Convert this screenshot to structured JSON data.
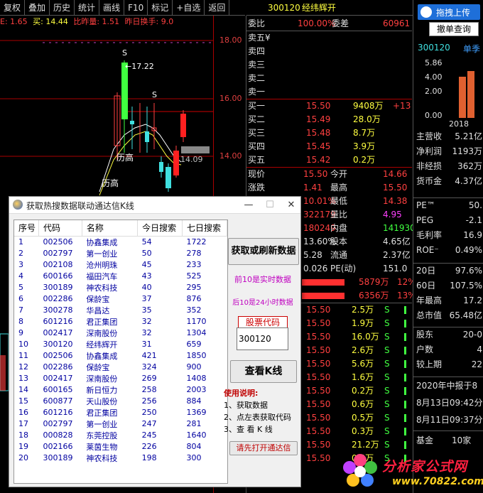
{
  "toolbar": {
    "items": [
      "复权",
      "叠加",
      "历史",
      "统计",
      "画线",
      "F10",
      "标记",
      "+自选",
      "返回"
    ]
  },
  "chart_info": {
    "prefix_label": "E: 1.65",
    "buy_label": "买: 14.44",
    "ratio_label": "比昨量: 1.51",
    "turnover_label": "昨日换手: 9.0"
  },
  "chart": {
    "price_levels": [
      "18.00",
      "16.00",
      "14.00"
    ],
    "annotations": [
      "S",
      "←17.22",
      "S",
      "历高",
      "历高",
      "14.09"
    ]
  },
  "orderbook": {
    "code": "300120",
    "name": "经纬辉开",
    "weibi_label": "委比",
    "weibi_value": "100.00%",
    "weicha_label": "委差",
    "weicha_value": "60961",
    "sell_rows": [
      {
        "label": "卖五¥",
        "price": "",
        "vol": ""
      },
      {
        "label": "卖四",
        "price": "",
        "vol": ""
      },
      {
        "label": "卖三",
        "price": "",
        "vol": ""
      },
      {
        "label": "卖二",
        "price": "",
        "vol": ""
      },
      {
        "label": "卖一",
        "price": "",
        "vol": ""
      }
    ],
    "buy_rows": [
      {
        "label": "买一",
        "price": "15.50",
        "vol": "9408万",
        "extra": "+13"
      },
      {
        "label": "买二",
        "price": "15.49",
        "vol": "28.0万",
        "extra": ""
      },
      {
        "label": "买三",
        "price": "15.48",
        "vol": "8.7万",
        "extra": ""
      },
      {
        "label": "买四",
        "price": "15.45",
        "vol": "3.9万",
        "extra": ""
      },
      {
        "label": "买五",
        "price": "15.42",
        "vol": "0.2万",
        "extra": ""
      }
    ],
    "stats": [
      {
        "l1": "现价",
        "v1": "15.50",
        "l2": "今开",
        "v2": "14.66"
      },
      {
        "l1": "涨跌",
        "v1": "1.41",
        "l2": "最高",
        "v2": "15.50"
      },
      {
        "l1": "",
        "v1": "10.01%",
        "l2": "最低",
        "v2": "14.38"
      },
      {
        "l1": "",
        "v1": "322179",
        "l2": "量比",
        "v2": "4.95"
      },
      {
        "l1": "",
        "v1": "180249",
        "l2": "内盘",
        "v2": "141930"
      },
      {
        "l1": "",
        "v1": "13.60%",
        "l2": "股本",
        "v2": "4.65亿"
      },
      {
        "l1": "",
        "v1": "5.28",
        "l2": "流通",
        "v2": "2.37亿"
      },
      {
        "l1": "",
        "v1": "0.026",
        "l2": "PE(动)",
        "v2": "151.0"
      }
    ],
    "flow_rows": [
      {
        "v": "5879万",
        "p": "12%"
      },
      {
        "v": "6356万",
        "p": "13%"
      }
    ],
    "ticks": [
      {
        "p": "15.50",
        "v": "2.5万",
        "s": "S"
      },
      {
        "p": "15.50",
        "v": "1.9万",
        "s": "S"
      },
      {
        "p": "15.50",
        "v": "16.0万",
        "s": "S"
      },
      {
        "p": "15.50",
        "v": "2.6万",
        "s": "S"
      },
      {
        "p": "15.50",
        "v": "5.6万",
        "s": "S"
      },
      {
        "p": "15.50",
        "v": "1.6万",
        "s": "S"
      },
      {
        "p": "15.50",
        "v": "0.2万",
        "s": "S"
      },
      {
        "p": "15.50",
        "v": "0.6万",
        "s": "S"
      },
      {
        "p": "15.50",
        "v": "0.5万",
        "s": "S"
      },
      {
        "p": "15.50",
        "v": "0.3万",
        "s": "S"
      },
      {
        "p": "15.50",
        "v": "21.2万",
        "s": "S"
      },
      {
        "p": "15.50",
        "v": "0.4万",
        "s": "S"
      }
    ]
  },
  "rightpanel": {
    "upload_label": "拖拽上传",
    "cancel_query_label": "撤单查询",
    "code": "300120",
    "season_label": "单季",
    "bar_axis": [
      "5.86",
      "4.00",
      "2.00",
      "0.00"
    ],
    "bar_year": "2018",
    "fin_rows": [
      {
        "l": "主营收",
        "v": "5.21亿"
      },
      {
        "l": "净利润",
        "v": "1193万"
      },
      {
        "l": "非经损",
        "v": "362万"
      },
      {
        "l": "货币金",
        "v": "4.37亿"
      }
    ],
    "ratio_rows": [
      {
        "l": "PE™",
        "v": "50."
      },
      {
        "l": "PEG",
        "v": "-2.1"
      },
      {
        "l": "毛利率",
        "v": "16.9"
      },
      {
        "l": "ROE⁻",
        "v": "0.49%"
      }
    ],
    "perf_rows": [
      {
        "l": "20日",
        "v": "97.6%"
      },
      {
        "l": "60日",
        "v": "107.5%"
      },
      {
        "l": "年最高",
        "v": "17.2"
      },
      {
        "l": "总市值",
        "v": "65.48亿"
      }
    ],
    "holder_rows": [
      {
        "l": "股东",
        "v": "20-0"
      },
      {
        "l": "户数",
        "v": "4"
      },
      {
        "l": "较上期",
        "v": "22"
      }
    ],
    "news_rows": [
      "2020年中报于8",
      "8月13日09:42分",
      "8月11日09:37分"
    ],
    "fund_label": "基金",
    "fund_value": "10家"
  },
  "dialog": {
    "title": "获取热搜数据联动通达信K线",
    "minimize": "—",
    "maximize": "☐",
    "close": "✕",
    "columns": [
      "序号",
      "代码",
      "名称",
      "今日搜索",
      "七日搜索"
    ],
    "rows": [
      [
        "1",
        "002506",
        "协鑫集成",
        "54",
        "1722"
      ],
      [
        "2",
        "002797",
        "第一创业",
        "50",
        "278"
      ],
      [
        "3",
        "002108",
        "沧州明珠",
        "45",
        "233"
      ],
      [
        "4",
        "600166",
        "福田汽车",
        "43",
        "525"
      ],
      [
        "5",
        "300189",
        "神农科技",
        "40",
        "295"
      ],
      [
        "6",
        "002286",
        "保龄宝",
        "37",
        "876"
      ],
      [
        "7",
        "300278",
        "华昌达",
        "35",
        "352"
      ],
      [
        "8",
        "601216",
        "君正集团",
        "32",
        "1170"
      ],
      [
        "9",
        "002417",
        "深南股份",
        "32",
        "1304"
      ],
      [
        "10",
        "300120",
        "经纬辉开",
        "31",
        "659"
      ],
      [
        "11",
        "002506",
        "协鑫集成",
        "421",
        "1850"
      ],
      [
        "12",
        "002286",
        "保龄宝",
        "324",
        "900"
      ],
      [
        "13",
        "002417",
        "深南股份",
        "269",
        "1408"
      ],
      [
        "14",
        "600165",
        "新日恒力",
        "258",
        "2003"
      ],
      [
        "15",
        "600877",
        "天山股份",
        "256",
        "884"
      ],
      [
        "16",
        "601216",
        "君正集团",
        "250",
        "1369"
      ],
      [
        "17",
        "002797",
        "第一创业",
        "247",
        "281"
      ],
      [
        "18",
        "000828",
        "东莞控股",
        "245",
        "1640"
      ],
      [
        "19",
        "002166",
        "莱茵生物",
        "226",
        "804"
      ],
      [
        "20",
        "300189",
        "神农科技",
        "198",
        "300"
      ]
    ],
    "fetch_button": "获取或刷新数据",
    "note_realtime": "前10是实时数据",
    "note_24h": "后10是24小时数据",
    "code_label": "股票代码",
    "code_value": "300120",
    "view_kline_button": "查看K线",
    "usage_title": "使用说明:",
    "usage_items": [
      "1、获取数据",
      "2、点左表获取代码",
      "3、查 看 K 线"
    ],
    "open_tdx_button": "请先打开通达信"
  },
  "watermark": {
    "brand": "分析家公式网",
    "url": "www.70822.com"
  },
  "colors": {
    "up": "#ff4040",
    "down": "#40ff40",
    "accent": "#1e6fd9"
  }
}
